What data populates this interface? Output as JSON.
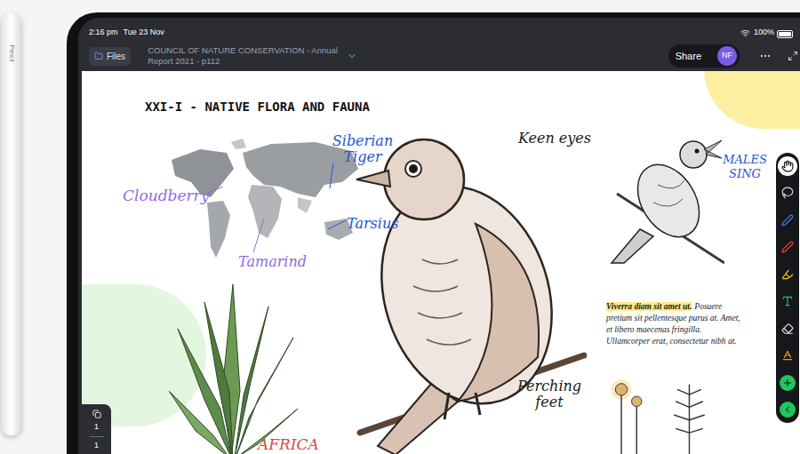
{
  "status_bar": {
    "time": "2:16 pm",
    "date": "Tue 23 Nov",
    "battery": "100%",
    "battery_level": 1
  },
  "nav_bar": {
    "files_button": "Files",
    "document_title": "COUNCIL OF NATURE CONSERVATION - Annual Report 2021 - p112",
    "share_button": "Share",
    "avatar": "NF"
  },
  "page": {
    "heading": "XXI-I - NATIVE FLORA AND FAUNA",
    "annotations": [
      {
        "text": "Cloudberry",
        "color": "#8e6be6"
      },
      {
        "text": "Siberian Tiger",
        "color": "#2456d6"
      },
      {
        "text": "Tarsius",
        "color": "#2456d6"
      },
      {
        "text": "Tamarind",
        "color": "#8e6be6"
      },
      {
        "text": "Keen eyes",
        "color": "#1a1a1a"
      },
      {
        "text": "MALES SING",
        "color": "#2456d6"
      },
      {
        "text": "Perching feet",
        "color": "#1a1a1a"
      },
      {
        "text": "AFRICA",
        "color": "#e0463c"
      }
    ],
    "paragraph": {
      "highlighted": "Viverra diam sit amet ut.",
      "body": "Posuere pretium sit pellentesque purus at. Amet, et libero maecenas fringilla. Ullamcorper erat, consectetur nibh at."
    }
  },
  "toolbar": {
    "tools": [
      {
        "kind": "hand",
        "selected": true,
        "color": "#ffffff"
      },
      {
        "kind": "lasso",
        "selected": false,
        "color": "#d9d9d9"
      },
      {
        "kind": "pen",
        "selected": false,
        "color": "#3b82f6"
      },
      {
        "kind": "pen",
        "selected": false,
        "color": "#ef4444"
      },
      {
        "kind": "highlighter",
        "selected": false,
        "color": "#facc15"
      },
      {
        "kind": "text",
        "selected": false,
        "color": "#22c55e"
      },
      {
        "kind": "eraser",
        "selected": false,
        "color": "#e5e5e5"
      },
      {
        "kind": "text-style",
        "selected": false,
        "color": "#f59e0b"
      },
      {
        "kind": "add",
        "selected": false,
        "color": "#22c55e"
      },
      {
        "kind": "more",
        "selected": false,
        "color": "#22c55e"
      }
    ]
  },
  "page_indicator": {
    "current": "1",
    "total": "1"
  },
  "pencil": {
    "label": "Pencil"
  }
}
